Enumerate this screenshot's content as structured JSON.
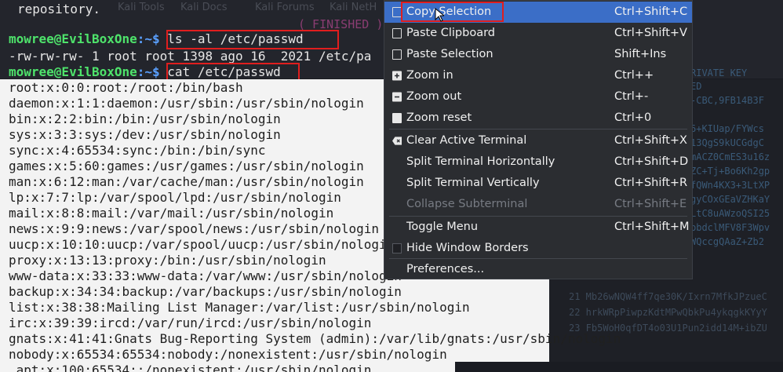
{
  "terminal": {
    "repo_line": "repository.",
    "kali_tabs": [
      "Kali Tools",
      "Kali Docs",
      "Kali Forums",
      "Kali NetH"
    ],
    "finished": "( FINISHED )",
    "prompt_user": "mowree@EvilBoxOne",
    "prompt_sep": ":~$ ",
    "cmd1": "ls -al /etc/passwd",
    "ls_output": "-rw-rw-rw- 1 root root 1398 ago 16  2021 /etc/pa",
    "cmd2": "cat /etc/passwd",
    "passwd_lines": [
      "root:x:0:0:root:/root:/bin/bash",
      "daemon:x:1:1:daemon:/usr/sbin:/usr/sbin/nologin",
      "bin:x:2:2:bin:/bin:/usr/sbin/nologin",
      "sys:x:3:3:sys:/dev:/usr/sbin/nologin",
      "sync:x:4:65534:sync:/bin:/bin/sync",
      "games:x:5:60:games:/usr/games:/usr/sbin/nologin",
      "man:x:6:12:man:/var/cache/man:/usr/sbin/nologin",
      "lp:x:7:7:lp:/var/spool/lpd:/usr/sbin/nologin",
      "mail:x:8:8:mail:/var/mail:/usr/sbin/nologin",
      "news:x:9:9:news:/var/spool/news:/usr/sbin/nologin",
      "uucp:x:10:10:uucp:/var/spool/uucp:/usr/sbin/nologin",
      "proxy:x:13:13:proxy:/bin:/usr/sbin/nologin",
      "www-data:x:33:33:www-data:/var/www:/usr/sbin/nologin",
      "backup:x:34:34:backup:/var/backups:/usr/sbin/nologin",
      "list:x:38:38:Mailing List Manager:/var/list:/usr/sbin/nologin",
      "irc:x:39:39:ircd:/var/run/ircd:/usr/sbin/nologin",
      "gnats:x:41:41:Gnats Bug-Reporting System (admin):/var/lib/gnats:/usr/sbin/nologin",
      "nobody:x:65534:65534:nobody:/nonexistent:/usr/sbin/nologin",
      "_apt:x:100:65534::/nonexistent:/usr/sbin/nologin"
    ],
    "bg_right": {
      "header": "RIVATE KEY",
      "lines": [
        "ED",
        "-CBC,9FB14B3F",
        "",
        "6+KIUap/FYWcs",
        "13QgS9kUCGdgC",
        "mACZ0CmES3u16z",
        "ZC+Tj+Bo6Kh2gp",
        "fQWn4KX3+3LtXP",
        "gyCOxGEaVZHKaY",
        "LtC8uAWzoQSI25",
        "bbdclMFV8F3Wpv",
        "WQccgQAaZ+Zb2"
      ],
      "numbered": [
        "20 mM1x7zW2Qwv...",
        "21 Mb26wNQW4ff7qe30K/Ixrn7MfkJPzueC",
        "22 hrkWRpPiwpzKdtMPwQbkPu4ykqgkKYyY",
        "23 Fb5WoH0qfDT4o03U1Pun2idd14M+ibZU"
      ]
    }
  },
  "context_menu": {
    "items": [
      {
        "label": "Copy Selection",
        "accel": "Ctrl+Shift+C",
        "icon": "clipboard-icon",
        "selected": true,
        "disabled": false
      },
      {
        "label": "Paste Clipboard",
        "accel": "Ctrl+Shift+V",
        "icon": "clipboard-icon",
        "selected": false,
        "disabled": false
      },
      {
        "label": "Paste Selection",
        "accel": "Shift+Ins",
        "icon": "clipboard-icon",
        "selected": false,
        "disabled": false
      },
      {
        "label": "Zoom in",
        "accel": "Ctrl++",
        "icon": "zoom-in-icon",
        "selected": false,
        "disabled": false
      },
      {
        "label": "Zoom out",
        "accel": "Ctrl+-",
        "icon": "zoom-out-icon",
        "selected": false,
        "disabled": false
      },
      {
        "label": "Zoom reset",
        "accel": "Ctrl+0",
        "icon": "zoom-reset-icon",
        "selected": false,
        "disabled": false
      },
      {
        "label": "Clear Active Terminal",
        "accel": "Ctrl+Shift+X",
        "icon": "clear-icon",
        "selected": false,
        "disabled": false
      },
      {
        "label": "Split Terminal Horizontally",
        "accel": "Ctrl+Shift+D",
        "icon": "",
        "selected": false,
        "disabled": false
      },
      {
        "label": "Split Terminal Vertically",
        "accel": "Ctrl+Shift+R",
        "icon": "",
        "selected": false,
        "disabled": false
      },
      {
        "label": "Collapse Subterminal",
        "accel": "Ctrl+Shift+E",
        "icon": "",
        "selected": false,
        "disabled": true
      },
      {
        "label": "Toggle Menu",
        "accel": "Ctrl+Shift+M",
        "icon": "",
        "selected": false,
        "disabled": false
      },
      {
        "label": "Hide Window Borders",
        "accel": "",
        "icon": "checkbox-icon",
        "selected": false,
        "disabled": false
      },
      {
        "label": "Preferences...",
        "accel": "",
        "icon": "",
        "selected": false,
        "disabled": false
      }
    ]
  }
}
